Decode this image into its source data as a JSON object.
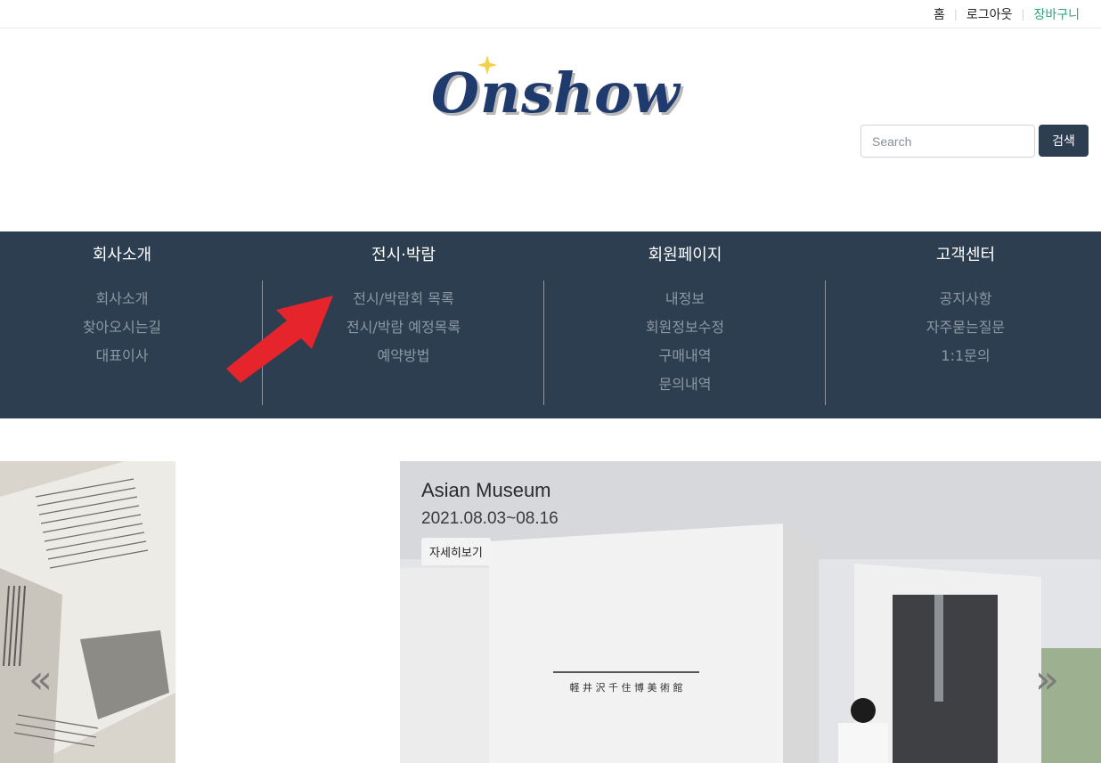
{
  "topbar": {
    "home": "홈",
    "logout": "로그아웃",
    "cart": "장바구니"
  },
  "logo": {
    "text": "Onshow"
  },
  "search": {
    "placeholder": "Search",
    "button": "검색"
  },
  "nav": {
    "columns": [
      {
        "title": "회사소개",
        "items": [
          "회사소개",
          "찾아오시는길",
          "대표이사"
        ]
      },
      {
        "title": "전시·박람",
        "items": [
          "전시/박람회 목록",
          "전시/박람 예정목록",
          "예약방법"
        ]
      },
      {
        "title": "회원페이지",
        "items": [
          "내정보",
          "회원정보수정",
          "구매내역",
          "문의내역"
        ]
      },
      {
        "title": "고객센터",
        "items": [
          "공지사항",
          "자주묻는질문",
          "1:1문의"
        ]
      }
    ]
  },
  "carousel": {
    "slide": {
      "title": "Asian Museum",
      "date": "2021.08.03~08.16",
      "button": "자세히보기"
    },
    "prev_icon": "«",
    "next_icon": "»"
  }
}
